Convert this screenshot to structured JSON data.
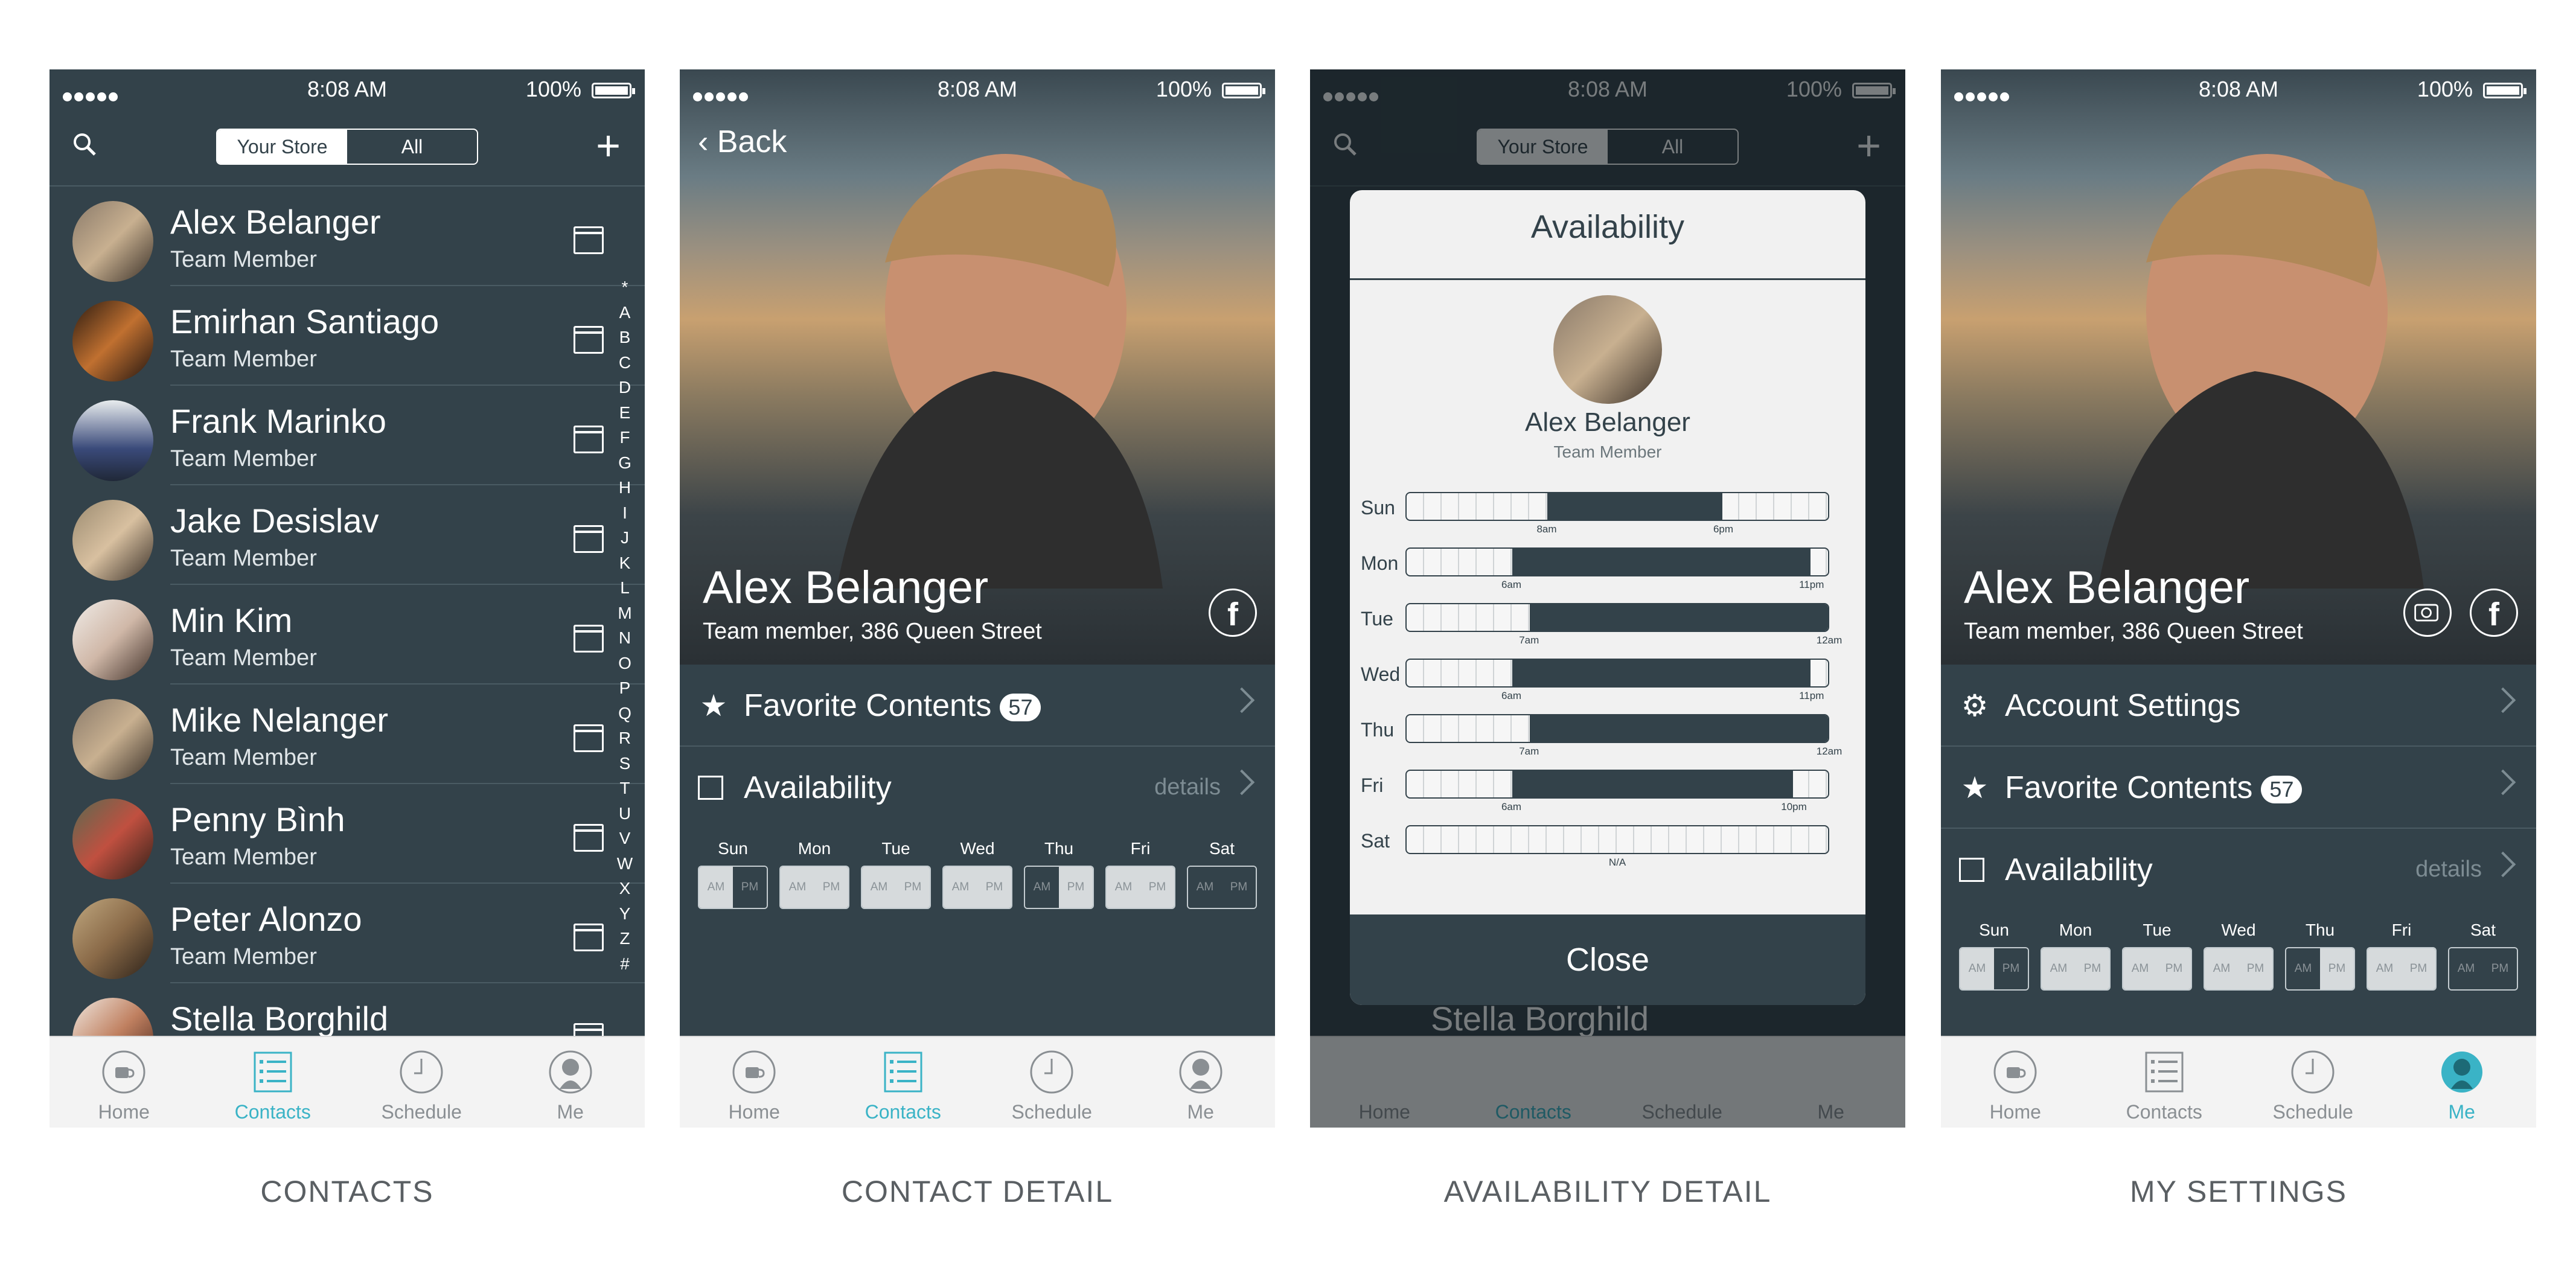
{
  "status": {
    "time": "8:08 AM",
    "battery": "100%"
  },
  "tabs": [
    "Home",
    "Contacts",
    "Schedule",
    "Me"
  ],
  "contacts": {
    "segment": [
      "Your Store",
      "All"
    ],
    "rows": [
      {
        "name": "Alex Belanger",
        "role": "Team Member"
      },
      {
        "name": "Emirhan Santiago",
        "role": "Team Member"
      },
      {
        "name": "Frank Marinko",
        "role": "Team Member"
      },
      {
        "name": "Jake Desislav",
        "role": "Team Member"
      },
      {
        "name": "Min Kim",
        "role": "Team Member"
      },
      {
        "name": "Mike Nelanger",
        "role": "Team Member"
      },
      {
        "name": "Penny Bình",
        "role": "Team Member"
      },
      {
        "name": "Peter Alonzo",
        "role": "Team Member"
      },
      {
        "name": "Stella Borghild",
        "role": ""
      }
    ],
    "alphabet": [
      "*",
      "A",
      "B",
      "C",
      "D",
      "E",
      "F",
      "G",
      "H",
      "I",
      "J",
      "K",
      "L",
      "M",
      "N",
      "O",
      "P",
      "Q",
      "R",
      "S",
      "T",
      "U",
      "V",
      "W",
      "X",
      "Y",
      "Z",
      "#"
    ]
  },
  "detail": {
    "back": "Back",
    "name": "Alex Belanger",
    "subtitle": "Team member, 386 Queen Street",
    "facebook": "f",
    "favorite_label": "Favorite Contents",
    "favorite_count": "57",
    "availability_label": "Availability",
    "details_link": "details",
    "week": [
      {
        "day": "Sun",
        "am": "AM",
        "pm": "PM",
        "am_on": true,
        "pm_on": false
      },
      {
        "day": "Mon",
        "am": "AM",
        "pm": "PM",
        "am_on": true,
        "pm_on": true
      },
      {
        "day": "Tue",
        "am": "AM",
        "pm": "PM",
        "am_on": true,
        "pm_on": true
      },
      {
        "day": "Wed",
        "am": "AM",
        "pm": "PM",
        "am_on": true,
        "pm_on": true
      },
      {
        "day": "Thu",
        "am": "AM",
        "pm": "PM",
        "am_on": false,
        "pm_on": true
      },
      {
        "day": "Fri",
        "am": "AM",
        "pm": "PM",
        "am_on": true,
        "pm_on": true
      },
      {
        "day": "Sat",
        "am": "AM",
        "pm": "PM",
        "am_on": false,
        "pm_on": false
      }
    ]
  },
  "availability_modal": {
    "title": "Availability",
    "name": "Alex Belanger",
    "role": "Team Member",
    "close": "Close",
    "days": [
      {
        "day": "Sun",
        "start": 8,
        "end": 18,
        "start_label": "8am",
        "end_label": "6pm"
      },
      {
        "day": "Mon",
        "start": 6,
        "end": 23,
        "start_label": "6am",
        "end_label": "11pm"
      },
      {
        "day": "Tue",
        "start": 7,
        "end": 24,
        "start_label": "7am",
        "end_label": "12am"
      },
      {
        "day": "Wed",
        "start": 6,
        "end": 23,
        "start_label": "6am",
        "end_label": "11pm"
      },
      {
        "day": "Thu",
        "start": 7,
        "end": 24,
        "start_label": "7am",
        "end_label": "12am"
      },
      {
        "day": "Fri",
        "start": 6,
        "end": 22,
        "start_label": "6am",
        "end_label": "10pm"
      },
      {
        "day": "Sat",
        "start": null,
        "end": null,
        "start_label": "N/A",
        "end_label": ""
      }
    ]
  },
  "settings": {
    "account_label": "Account Settings",
    "favorite_label": "Favorite Contents",
    "favorite_count": "57",
    "availability_label": "Availability",
    "details_link": "details"
  },
  "captions": [
    "CONTACTS",
    "CONTACT DETAIL",
    "AVAILABILITY DETAIL",
    "MY SETTINGS"
  ],
  "colors": {
    "panel": "#33424a",
    "accent": "#3ab3c6",
    "tabbar": "#f3f3f3"
  }
}
